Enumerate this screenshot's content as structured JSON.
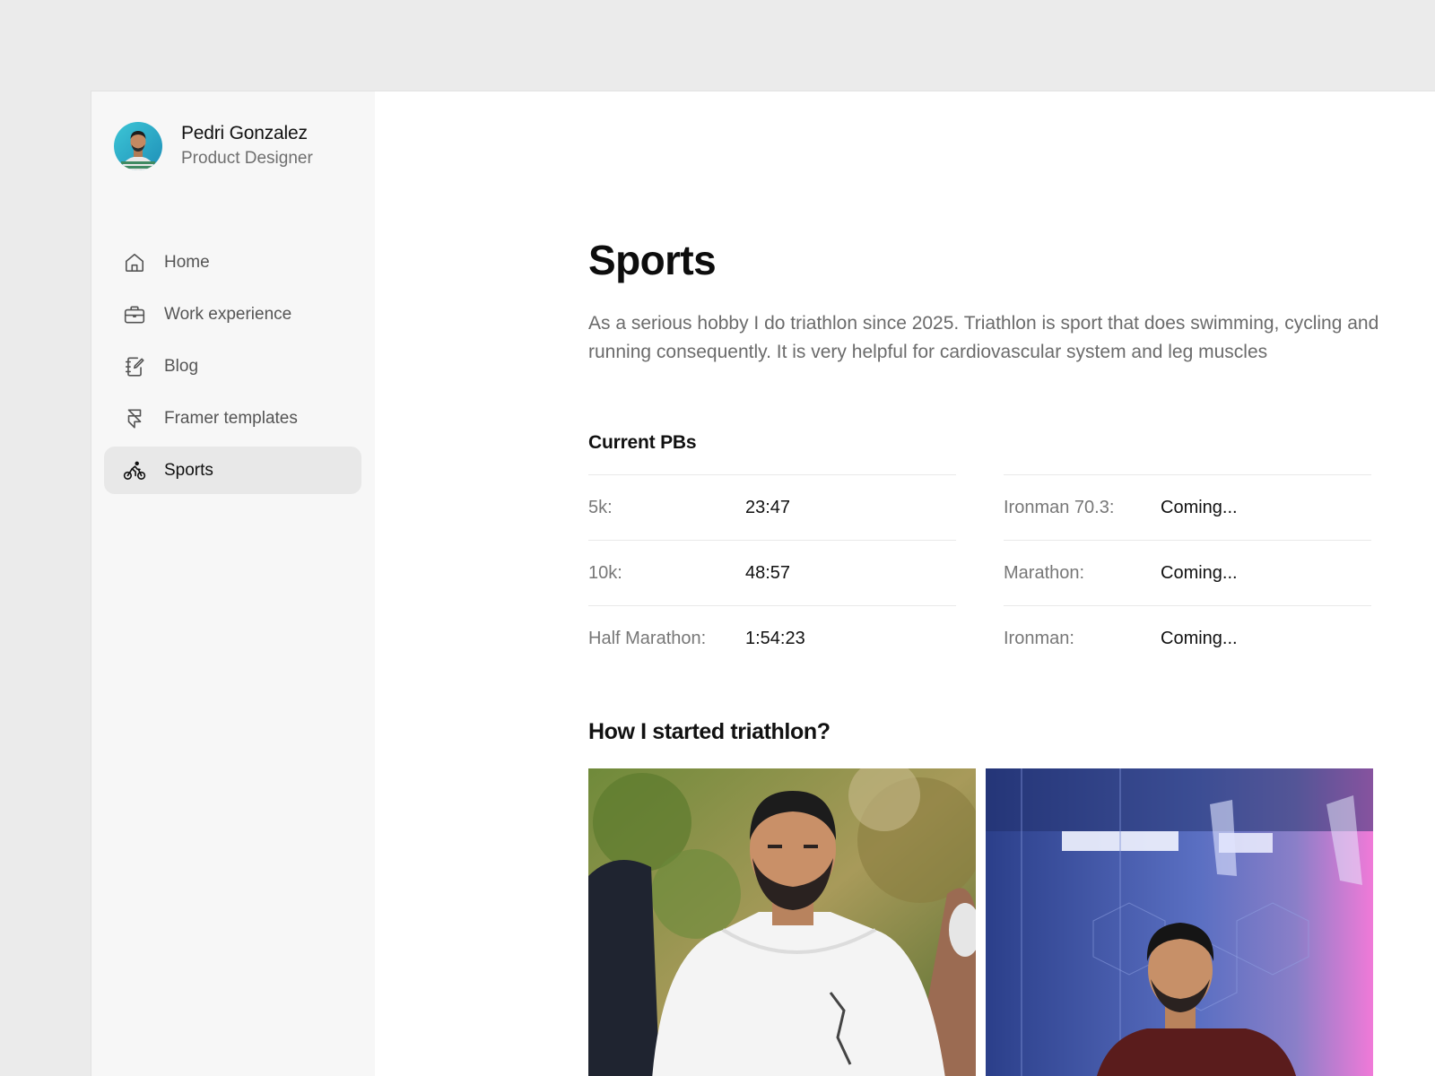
{
  "profile": {
    "name": "Pedri Gonzalez",
    "role": "Product Designer"
  },
  "sidebar": {
    "items": [
      {
        "label": "Home",
        "icon": "home-icon"
      },
      {
        "label": "Work experience",
        "icon": "briefcase-icon"
      },
      {
        "label": "Blog",
        "icon": "notebook-edit-icon"
      },
      {
        "label": "Framer templates",
        "icon": "framer-icon"
      },
      {
        "label": "Sports",
        "icon": "bicycle-icon",
        "active": true
      }
    ]
  },
  "main": {
    "title": "Sports",
    "intro": "As a serious hobby I do triathlon since 2025. Triathlon is sport that does swimming, cycling and running consequently. It is very helpful for cardiovascular system and leg muscles",
    "pbs_heading": "Current PBs",
    "pbs_left": [
      {
        "label": "5k:",
        "value": "23:47"
      },
      {
        "label": "10k:",
        "value": "48:57"
      },
      {
        "label": "Half Marathon:",
        "value": "1:54:23"
      }
    ],
    "pbs_right": [
      {
        "label": "Ironman 70.3:",
        "value": "Coming..."
      },
      {
        "label": "Marathon:",
        "value": "Coming..."
      },
      {
        "label": "Ironman:",
        "value": "Coming..."
      }
    ],
    "how_heading": "How I started triathlon?"
  },
  "colors": {
    "page_bg": "#ebebeb",
    "sidebar_bg": "#f7f7f7",
    "active_item_bg": "#e8e8e8",
    "muted_text": "#6b6b6b"
  }
}
